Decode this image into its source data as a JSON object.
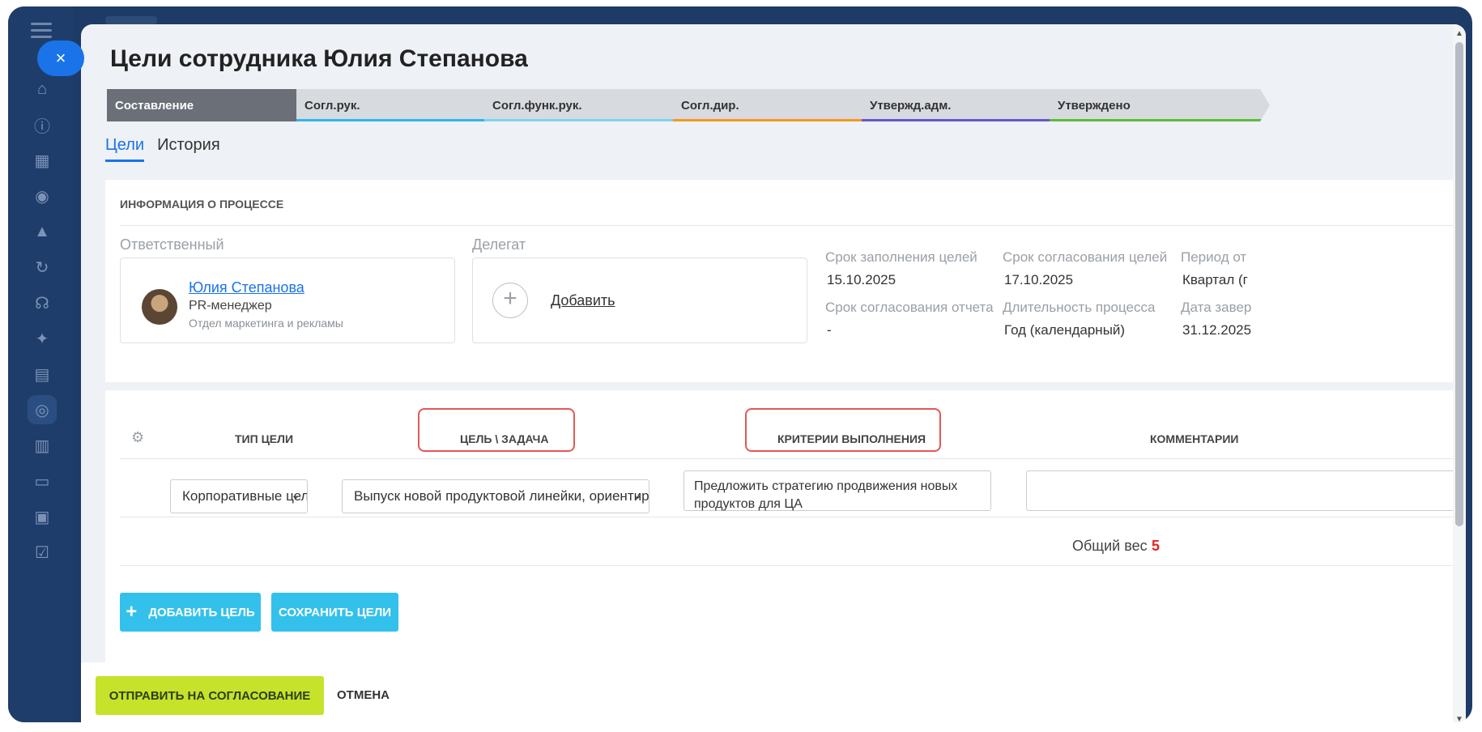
{
  "modal": {
    "close_symbol": "×",
    "title": "Цели сотрудника Юлия Степанова"
  },
  "stages": [
    {
      "label": "Составление",
      "active": true,
      "color": "#6a6f78"
    },
    {
      "label": "Согл.рук.",
      "active": false,
      "color": "#2fb6e8"
    },
    {
      "label": "Согл.функ.рук.",
      "active": false,
      "color": "#7fd3ef"
    },
    {
      "label": "Согл.дир.",
      "active": false,
      "color": "#f39a1e"
    },
    {
      "label": "Утвержд.адм.",
      "active": false,
      "color": "#6a55c9"
    },
    {
      "label": "Утверждено",
      "active": false,
      "color": "#5dbb3f"
    }
  ],
  "tabs": [
    {
      "label": "Цели",
      "active": true
    },
    {
      "label": "История",
      "active": false
    }
  ],
  "process_info": {
    "heading": "ИНФОРМАЦИЯ О ПРОЦЕССЕ",
    "responsible_label": "Ответственный",
    "responsible": {
      "name": "Юлия Степанова",
      "role": "PR-менеджер",
      "department": "Отдел маркетинга и рекламы"
    },
    "delegate_label": "Делегат",
    "delegate_add": "Добавить",
    "meta": [
      {
        "label": "Срок заполнения целей",
        "value": "15.10.2025"
      },
      {
        "label": "Срок согласования целей",
        "value": "17.10.2025"
      },
      {
        "label": "Период от",
        "value": "Квартал (г"
      },
      {
        "label": "Срок согласования отчета",
        "value": "-"
      },
      {
        "label": "Длительность процесса",
        "value": "Год (календарный)"
      },
      {
        "label": "Дата завер",
        "value": "31.12.2025"
      }
    ]
  },
  "goals_table": {
    "columns": [
      "ТИП ЦЕЛИ",
      "ЦЕЛЬ \\ ЗАДАЧА",
      "КРИТЕРИИ ВЫПОЛНЕНИЯ",
      "КОММЕНТАРИИ"
    ],
    "rows": [
      {
        "goal_type": "Корпоративные цели",
        "goal": "Выпуск новой продуктовой линейки, ориентированной",
        "criteria": "Предложить стратегию продвижения новых продуктов для ЦА",
        "comment": ""
      }
    ],
    "total_weight_label": "Общий вес",
    "total_weight_value": "5"
  },
  "buttons": {
    "add_goal": "ДОБАВИТЬ ЦЕЛЬ",
    "save_goals": "СОХРАНИТЬ ЦЕЛИ",
    "send_for_approval": "ОТПРАВИТЬ НА СОГЛАСОВАНИЕ",
    "cancel": "ОТМЕНА"
  },
  "colors": {
    "accent_blue": "#1a73e8",
    "button_cyan": "#33c1ec",
    "button_lime": "#c6e22b",
    "highlight_red": "#e35757"
  }
}
